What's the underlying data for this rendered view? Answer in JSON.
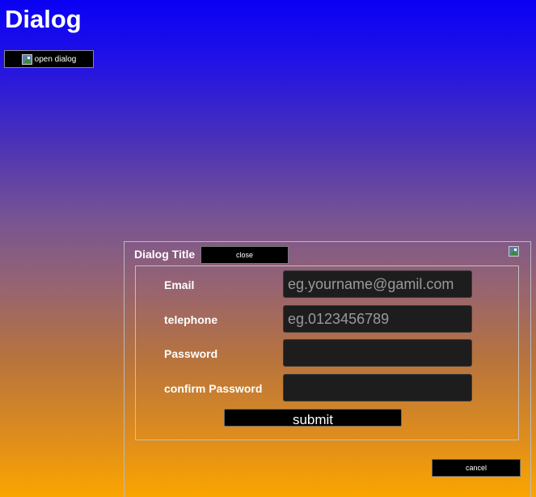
{
  "page": {
    "title": "Dialog"
  },
  "open_dialog": {
    "label": "open dialog",
    "icon": "broken-image-icon"
  },
  "dialog": {
    "title": "Dialog Title",
    "close_label": "close",
    "icon": "broken-image-icon",
    "form": {
      "fields": [
        {
          "label": "Email",
          "value": "",
          "placeholder": "eg.yourname@gamil.com"
        },
        {
          "label": "telephone",
          "value": "",
          "placeholder": "eg.0123456789"
        },
        {
          "label": "Password",
          "value": "",
          "placeholder": ""
        },
        {
          "label": "confirm Password",
          "value": "",
          "placeholder": ""
        }
      ],
      "submit_label": "submit"
    },
    "cancel_label": "cancel"
  },
  "colors": {
    "background_top": "#0a00f4",
    "background_bottom": "#fba500",
    "button_bg": "#000000",
    "input_bg": "#1d1d1d",
    "text": "#ffffff"
  }
}
